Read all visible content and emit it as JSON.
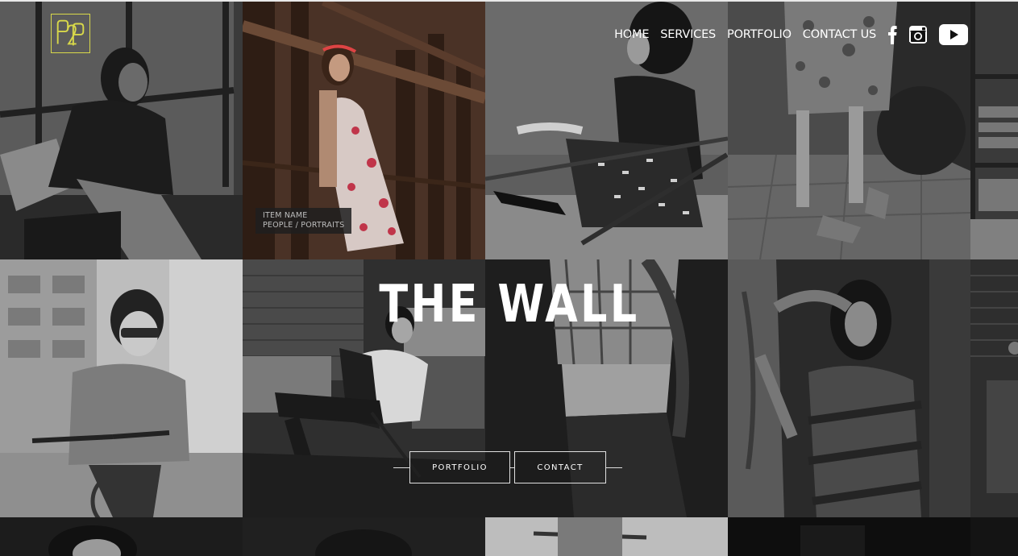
{
  "brand": {
    "logo_text": "P2P",
    "accent": "#d8d84a"
  },
  "nav": {
    "items": [
      {
        "label": "HOME"
      },
      {
        "label": "SERVICES"
      },
      {
        "label": "PORTFOLIO"
      },
      {
        "label": "CONTACT US"
      }
    ],
    "social": [
      "facebook-icon",
      "instagram-icon",
      "youtube-icon"
    ]
  },
  "featured_item": {
    "name": "ITEM NAME",
    "category": "PEOPLE / PORTRAITS"
  },
  "hero": {
    "title": "THE WALL",
    "buttons": [
      {
        "label": "PORTFOLIO"
      },
      {
        "label": "CONTACT"
      }
    ]
  },
  "colors": {
    "text": "#ffffff",
    "button_border": "#e0e0e0",
    "caption_bg": "#1e1e1e",
    "logo_border": "#d8d84a"
  }
}
